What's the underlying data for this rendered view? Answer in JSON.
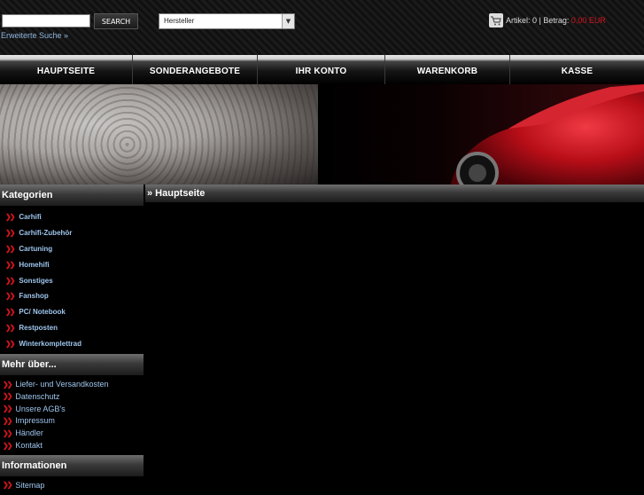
{
  "header": {
    "search_input_value": "",
    "search_button": "SEARCH",
    "advanced_search": "Erweiterte Suche »",
    "manufacturer_select": "Hersteller",
    "cart_prefix": "Artikel: 0 | Betrag:",
    "cart_amount": "0,00 EUR"
  },
  "nav": {
    "items": [
      {
        "label": "HAUPTSEITE"
      },
      {
        "label": "SONDERANGEBOTE"
      },
      {
        "label": "IHR KONTO"
      },
      {
        "label": "WARENKORB"
      },
      {
        "label": "KASSE"
      }
    ]
  },
  "sidebar": {
    "categories_title": "Kategorien",
    "categories": [
      "Carhifi",
      "Carhifi-Zubehör",
      "Cartuning",
      "Homehifi",
      "Sonstiges",
      "Fanshop",
      "PC/ Notebook",
      "Restposten",
      "Winterkomplettrad"
    ],
    "more_title": "Mehr über...",
    "more_items": [
      "Liefer- und Versandkosten",
      "Datenschutz",
      "Unsere AGB's",
      "Impressum",
      "Händler",
      "Kontakt"
    ],
    "info_title": "Informationen",
    "info_items": [
      "Sitemap"
    ]
  },
  "main": {
    "breadcrumb": "» Hauptseite"
  },
  "colors": {
    "accent_red": "#d8141e",
    "link_blue": "#9fc6ee"
  }
}
